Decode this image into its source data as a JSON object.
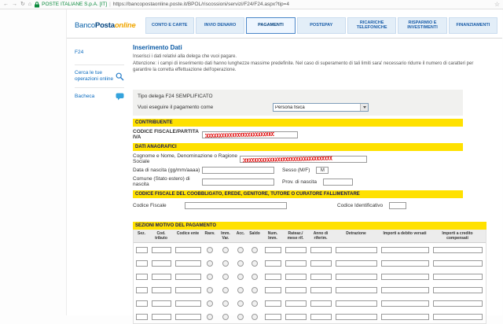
{
  "browser": {
    "back": "←",
    "forward": "→",
    "refresh": "↻",
    "home": "⌂",
    "security_label": "POSTE ITALIANE S.p.A. [IT]",
    "separator": "|",
    "url": "https://bancopostaonline.poste.it/BPOL/riscossioni/servizi/F24/F24.aspx?tip=4",
    "star": "☆"
  },
  "header": {
    "logo_banco": "Banco",
    "logo_posta": "Posta",
    "logo_online": "online",
    "nav": [
      {
        "label": "CONTO E CARTE"
      },
      {
        "label": "INVIO DENARO"
      },
      {
        "label": "PAGAMENTI"
      },
      {
        "label": "POSTEPAY"
      },
      {
        "label": "RICARICHE TELEFONICHE"
      },
      {
        "label": "RISPARMIO E INVESTIMENTI"
      },
      {
        "label": "FINANZIAMENTI"
      }
    ]
  },
  "sidebar": {
    "f24": "F24",
    "cerca": "Cerca le tue operazioni online",
    "bacheca": "Bacheca"
  },
  "main": {
    "title": "Inserimento Dati",
    "intro1": "Inserisci i dati relativi alla delega che vuoi pagare.",
    "intro2": "Attenzione: i campi di inserimento dati hanno lunghezze massime predefinite. Nel caso di superamento di tali limiti sara' necessario ridurre il numero di caratteri per garantire la corretta effettuazione dell'operazione.",
    "delega": {
      "tipo": "Tipo delega F24 SEMPLIFICATO",
      "come_label": "Vuoi eseguire il pagamento come",
      "come_value": "Persona fisica"
    },
    "bars": {
      "contribuente": "CONTRIBUENTE",
      "dati_anagrafici": "DATI ANAGRAFICI",
      "coobbligato": "CODICE FISCALE DEL COOBBLIGATO, EREDE, GENITORE, TUTORE O CURATORE FALLIMENTARE",
      "sezioni": "SEZIONI MOTIVO DEL PAGAMENTO"
    },
    "fields": {
      "codice_fiscale_piva": "CODICE FISCALE/PARTITA IVA",
      "cognome": "Cognome e Nome, Denominazione o Ragione Sociale",
      "data_nascita": "Data di nascita (gg/mm/aaaa)",
      "sesso": "Sesso (M/F)",
      "sesso_value": "M",
      "comune": "Comune (Stato estero) di nascita",
      "prov": "Prov. di nascita",
      "codice_fiscale": "Codice Fiscale",
      "codice_identificativo": "Codice Identificativo"
    },
    "table": {
      "headers": [
        "Sez.",
        "Cod. tributo",
        "Codice ente",
        "Ravv.",
        "Imm. Var.",
        "Acc.",
        "Saldo",
        "Num. Imm.",
        "Rateaz./ mese rif.",
        "Anno di riferim.",
        "Detrazione",
        "Importi a debito versati",
        "Importi a credito compensati"
      ],
      "column_kinds": [
        "input",
        "input",
        "input",
        "radio",
        "radio",
        "radio",
        "radio",
        "input",
        "input",
        "input",
        "input",
        "input",
        "input"
      ],
      "row_count": 6
    }
  },
  "colors": {
    "accent_blue": "#00539f",
    "section_yellow": "#ffe100",
    "link_blue": "#0b6bbf",
    "secure_green": "#0a8a3c",
    "redaction_red": "#e01010"
  }
}
